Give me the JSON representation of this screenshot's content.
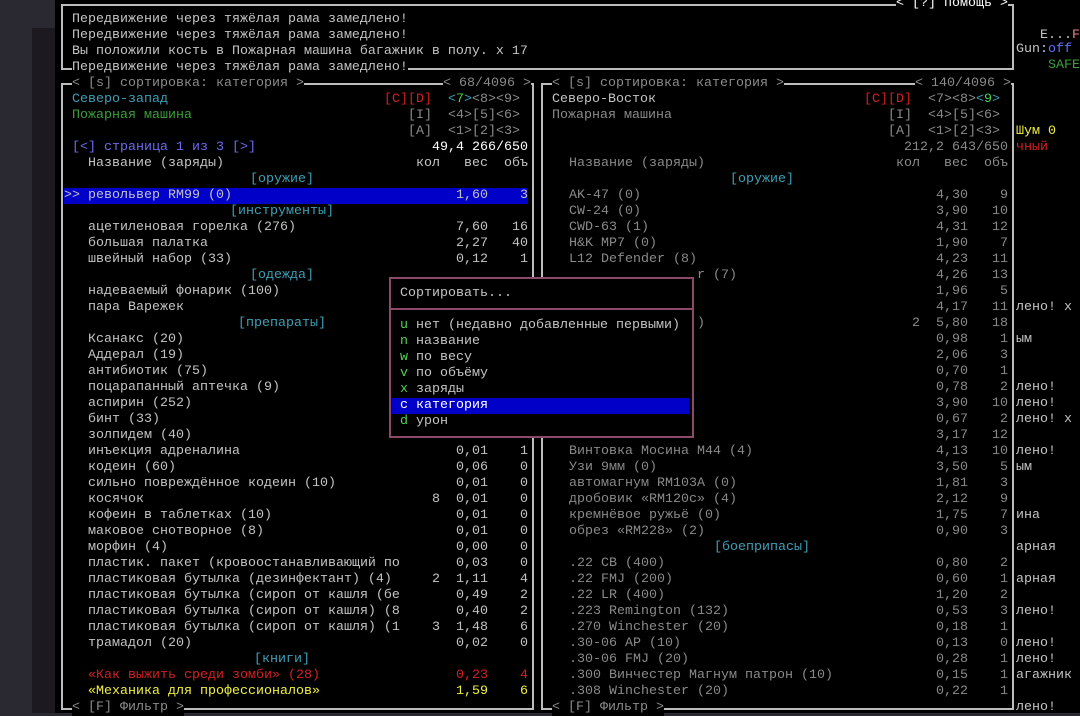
{
  "messages": {
    "help_label": "< [?] помощь >",
    "lines": [
      "Передвижение через тяжёлая рама замедлено!",
      "Передвижение через тяжёлая рама замедлено!",
      "Вы положили кость в Пожарная машина багажник в полу. x 17",
      "Передвижение через тяжёлая рама замедлено!"
    ]
  },
  "left_panel": {
    "sort_label": "< [s] сортировка: категория >",
    "count": "< 68/4096 >",
    "location": "Северо-запад",
    "source": "Пожарная машина",
    "keys_cd": "[C][D]",
    "keys_i": "[I]",
    "keys_a": "[A]",
    "dir_row1": [
      "<",
      "7",
      ">",
      "<8><9>"
    ],
    "dir_row2": "<4>[5]<6>",
    "dir_row3": "<1>[2]<3>",
    "page": "[<] страница 1 из 3 [>]",
    "totals": "49,4 266/650",
    "filter_label": "< [F] Фильтр >",
    "columns": {
      "name": "Название (заряды)",
      "qty": "кол",
      "weight": "вес",
      "volume": "объ"
    },
    "selected_marker": ">>",
    "rows": [
      {
        "category": "[оружие]"
      },
      {
        "name": "револьвер RM99 (0)",
        "qty": "",
        "weight": "1,60",
        "volume": "3",
        "selected": true
      },
      {
        "category": "[инструменты]"
      },
      {
        "name": "ацетиленовая горелка (276)",
        "qty": "",
        "weight": "7,60",
        "volume": "16"
      },
      {
        "name": "большая палатка",
        "qty": "",
        "weight": "2,27",
        "volume": "40"
      },
      {
        "name": "швейный набор (33)",
        "qty": "",
        "weight": "0,12",
        "volume": "1"
      },
      {
        "category": "[одежда]"
      },
      {
        "name": "надеваемый фонарик (100)"
      },
      {
        "name": "пара Варежек"
      },
      {
        "category": "[препараты]"
      },
      {
        "name": "Ксанакс (20)"
      },
      {
        "name": "Аддерал (19)"
      },
      {
        "name": "антибиотик (75)"
      },
      {
        "name": "поцарапанный аптечка (9)"
      },
      {
        "name": "аспирин (252)"
      },
      {
        "name": "бинт (33)"
      },
      {
        "name": "золпидем (40)"
      },
      {
        "name": "инъекция адреналина",
        "qty": "",
        "weight": "0,01",
        "volume": "1"
      },
      {
        "name": "кодеин (60)",
        "qty": "",
        "weight": "0,06",
        "volume": "0"
      },
      {
        "name": "сильно повреждённое кодеин (10)",
        "qty": "",
        "weight": "0,01",
        "volume": "0"
      },
      {
        "name": "косячок",
        "qty": "8",
        "weight": "0,01",
        "volume": "0"
      },
      {
        "name": "кофеин в таблетках (10)",
        "qty": "",
        "weight": "0,01",
        "volume": "0"
      },
      {
        "name": "маковое снотворное (8)",
        "qty": "",
        "weight": "0,01",
        "volume": "0"
      },
      {
        "name": "морфин (4)",
        "qty": "",
        "weight": "0,00",
        "volume": "0"
      },
      {
        "name": "пластик. пакет (кровоостанавливающий по",
        "qty": "",
        "weight": "0,03",
        "volume": "0"
      },
      {
        "name": "пластиковая бутылка (дезинфектант) (4)",
        "qty": "2",
        "weight": "1,11",
        "volume": "4"
      },
      {
        "name": "пластиковая бутылка (сироп от кашля (бе",
        "qty": "",
        "weight": "0,49",
        "volume": "2"
      },
      {
        "name": "пластиковая бутылка (сироп от кашля) (8",
        "qty": "",
        "weight": "0,40",
        "volume": "2"
      },
      {
        "name": "пластиковая бутылка (сироп от кашля) (1",
        "qty": "3",
        "weight": "1,48",
        "volume": "6"
      },
      {
        "name": "трамадол (20)",
        "qty": "",
        "weight": "0,02",
        "volume": "0"
      },
      {
        "category": "[книги]"
      },
      {
        "name": "«Как выжить среди зомби» (28)",
        "qty": "",
        "weight": "0,23",
        "volume": "4",
        "color": "red"
      },
      {
        "name": "«Механика для профессионалов»",
        "qty": "",
        "weight": "1,59",
        "volume": "6",
        "color": "yellow"
      }
    ]
  },
  "right_panel": {
    "sort_label": "< [s] сортировка: категория >",
    "count": "< 140/4096 >",
    "location": "Северо-Восток",
    "source": "Пожарная машина",
    "keys_cd": "[C][D]",
    "keys_i": "[I]",
    "keys_a": "[A]",
    "dir_row1": [
      "<7><8>",
      "<",
      "9",
      ">"
    ],
    "dir_row2": "<4>[5]<6>",
    "dir_row3": "<1>[2]<3>",
    "totals": "212,2 643/650",
    "filter_label": "< [F] Фильтр >",
    "columns": {
      "name": "Название (заряды)",
      "qty": "кол",
      "weight": "вес",
      "volume": "объ"
    },
    "rows": [
      {
        "category": "[оружие]"
      },
      {
        "name": "AK-47 (0)",
        "weight": "4,30",
        "volume": "9"
      },
      {
        "name": "CW-24 (0)",
        "weight": "3,90",
        "volume": "10"
      },
      {
        "name": "CWD-63 (1)",
        "weight": "4,31",
        "volume": "12"
      },
      {
        "name": "H&K MP7 (0)",
        "weight": "1,90",
        "volume": "7"
      },
      {
        "name": "L12 Defender (8)",
        "weight": "4,23",
        "volume": "11"
      },
      {
        "name": "r (7)",
        "weight": "4,26",
        "volume": "13",
        "partial": true
      },
      {
        "name": "",
        "weight": "1,96",
        "volume": "5"
      },
      {
        "name": "",
        "weight": "4,17",
        "volume": "11"
      },
      {
        "name": ")",
        "qty": "2",
        "weight": "5,80",
        "volume": "18",
        "partial": true
      },
      {
        "name": "",
        "weight": "0,98",
        "volume": "1"
      },
      {
        "name": "",
        "weight": "2,06",
        "volume": "3"
      },
      {
        "name": "",
        "weight": "0,70",
        "volume": "1"
      },
      {
        "name": "",
        "weight": "0,78",
        "volume": "2"
      },
      {
        "name": "",
        "weight": "3,90",
        "volume": "10"
      },
      {
        "name": "",
        "weight": "0,67",
        "volume": "2"
      },
      {
        "name": "",
        "weight": "3,17",
        "volume": "12"
      },
      {
        "name": "Винтовка Мосина М44 (4)",
        "weight": "4,13",
        "volume": "10"
      },
      {
        "name": "Узи 9мм (0)",
        "weight": "3,50",
        "volume": "5"
      },
      {
        "name": "автомагнум RM103A (0)",
        "weight": "1,81",
        "volume": "3"
      },
      {
        "name": "дробовик «RM120c» (4)",
        "weight": "2,12",
        "volume": "9"
      },
      {
        "name": "кремнёвое ружьё (0)",
        "weight": "1,75",
        "volume": "7"
      },
      {
        "name": "обрез «RM228» (2)",
        "weight": "0,90",
        "volume": "3"
      },
      {
        "category": "[боеприпасы]"
      },
      {
        "name": ".22 CB (400)",
        "weight": "0,80",
        "volume": "2"
      },
      {
        "name": ".22 FMJ (200)",
        "weight": "0,60",
        "volume": "1"
      },
      {
        "name": ".22 LR (400)",
        "weight": "1,20",
        "volume": "2"
      },
      {
        "name": ".223 Remington (132)",
        "weight": "0,53",
        "volume": "3"
      },
      {
        "name": ".270 Winchester (20)",
        "weight": "0,18",
        "volume": "1"
      },
      {
        "name": ".30-06 AP (10)",
        "weight": "0,13",
        "volume": "0"
      },
      {
        "name": ".30-06 FMJ (20)",
        "weight": "0,28",
        "volume": "1"
      },
      {
        "name": ".300 Винчестер Магнум патрон (10)",
        "weight": "0,15",
        "volume": "1"
      },
      {
        "name": ".308 Winchester (20)",
        "weight": "0,22",
        "volume": "1"
      }
    ]
  },
  "sort_popup": {
    "title": "Сортировать...",
    "options": [
      {
        "key": "u",
        "label": "нет (недавно добавленные первыми)"
      },
      {
        "key": "n",
        "label": "название"
      },
      {
        "key": "w",
        "label": "по весу"
      },
      {
        "key": "v",
        "label": "по объёму"
      },
      {
        "key": "x",
        "label": "заряды"
      },
      {
        "key": "c",
        "label": "категория",
        "selected": true
      },
      {
        "key": "d",
        "label": "урон"
      }
    ]
  },
  "sidebar_overflow": {
    "status_e": "E...",
    "status_f": "F",
    "gun_label": "Gun:",
    "gun_value": "off",
    "safe": "SAFE",
    "noise": "Шум 0",
    "red_fragment": "чный",
    "fragments": [
      {
        "row": 18,
        "text": "лено! x"
      },
      {
        "row": 20,
        "text": "ым"
      },
      {
        "row": 23,
        "text": "лено!"
      },
      {
        "row": 24,
        "text": "лено!"
      },
      {
        "row": 25,
        "text": "лено! x"
      },
      {
        "row": 27,
        "text": "лено!"
      },
      {
        "row": 28,
        "text": "ым"
      },
      {
        "row": 31,
        "text": "ина"
      },
      {
        "row": 33,
        "text": "арная"
      },
      {
        "row": 35,
        "text": "арная"
      },
      {
        "row": 37,
        "text": "лено!"
      },
      {
        "row": 39,
        "text": "лено!"
      },
      {
        "row": 40,
        "text": "лено!"
      },
      {
        "row": 41,
        "text": "агажник"
      },
      {
        "row": 43,
        "text": "лено!"
      }
    ]
  },
  "colors": {
    "highlight": "#0000c8",
    "category": "#3f9fb6",
    "popup_border": "#8a4a68",
    "warning": "#d42020",
    "note": "#f0f040"
  }
}
